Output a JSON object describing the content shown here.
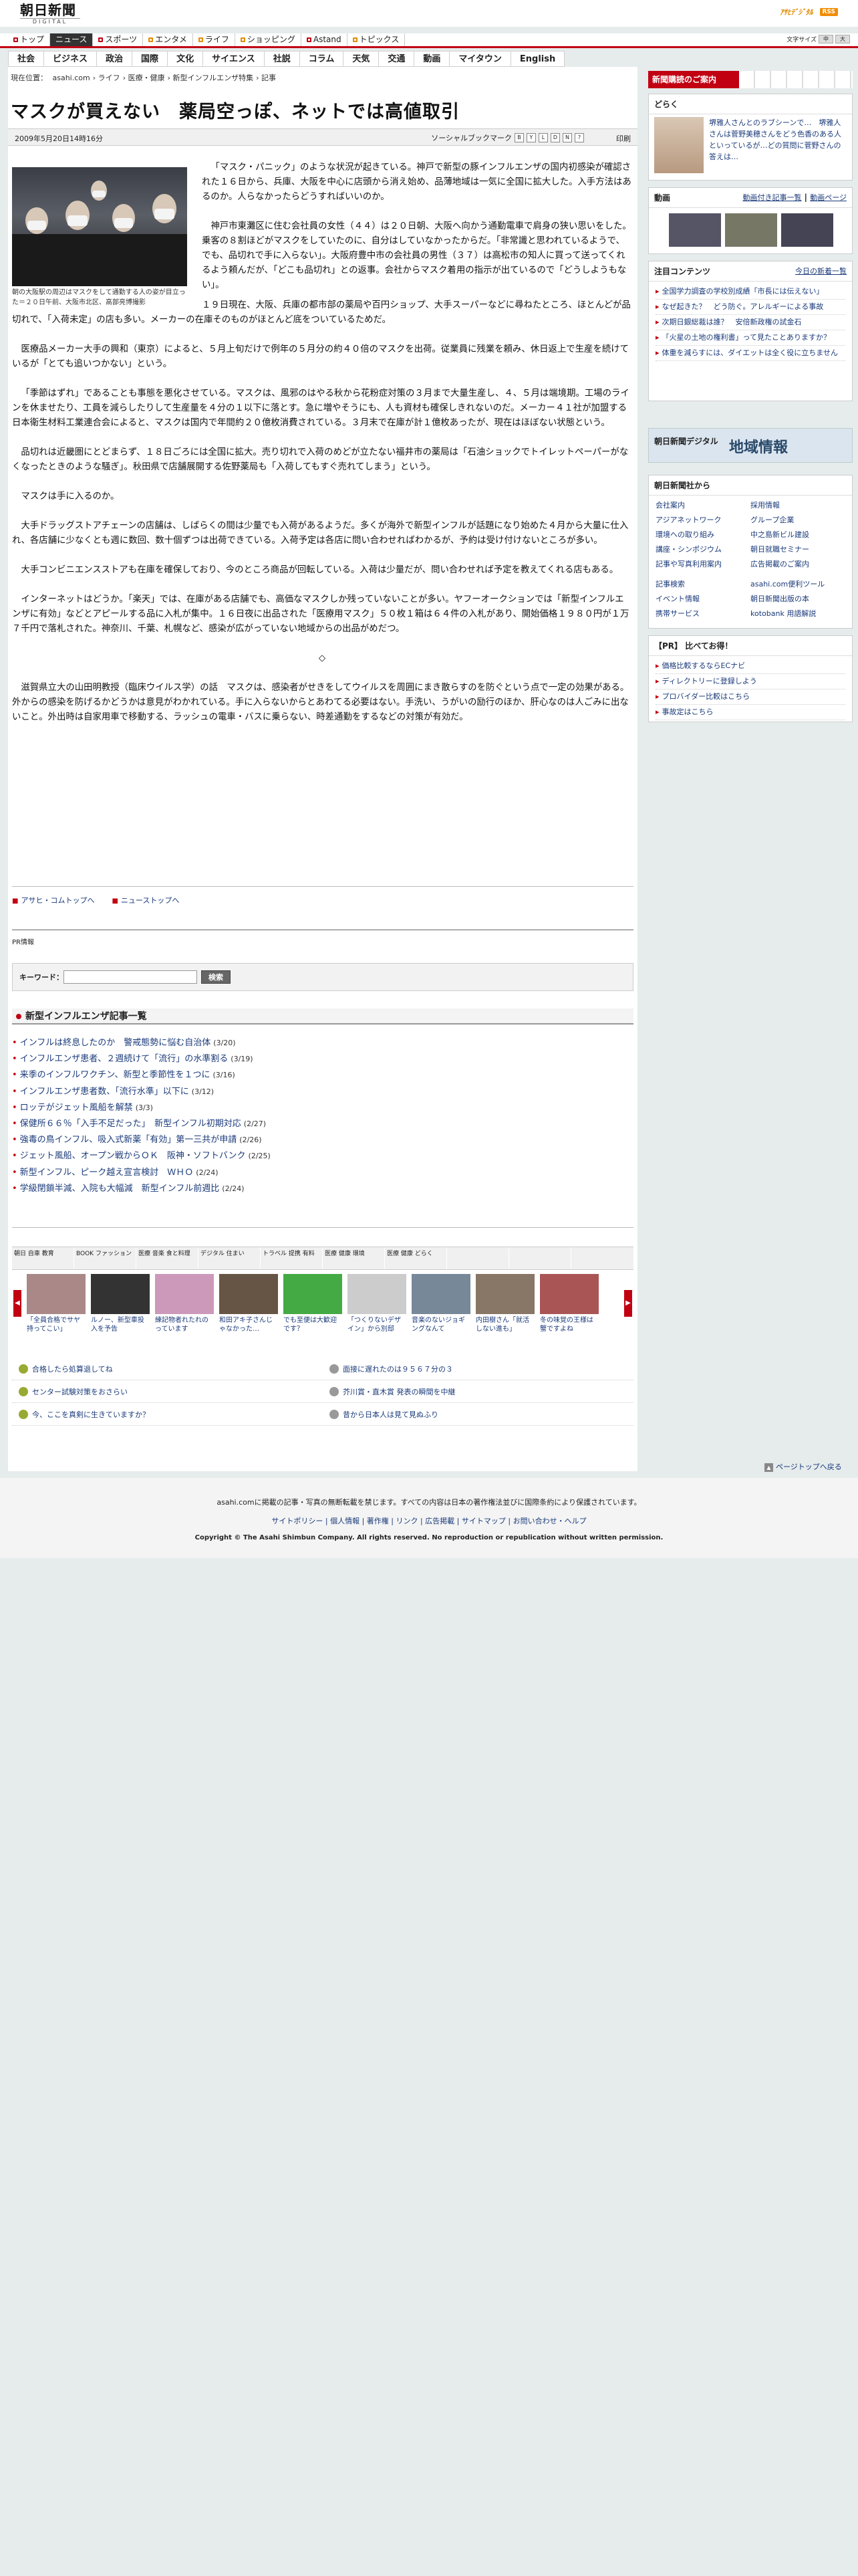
{
  "header": {
    "logo_jp": "朝日新聞",
    "logo_en": "DIGITAL",
    "pr_logo": "ｱｻﾋﾃﾞｼﾞﾀﾙ",
    "rss": "RSS",
    "text_size_label": "文字サイズ"
  },
  "global_nav": [
    "トップ",
    "ニュース",
    "スポーツ",
    "エンタメ",
    "ライフ",
    "ショッピング",
    "Astand",
    "トピックス"
  ],
  "sub_nav": [
    "社会",
    "ビジネス",
    "政治",
    "国際",
    "文化",
    "サイエンス",
    "社説",
    "コラム",
    "天気",
    "交通",
    "動画",
    "マイタウン",
    "English"
  ],
  "breadcrumb": [
    "現在位置：",
    "asahi.com",
    "ライフ",
    "医療・健康",
    "新型インフルエンザ特集",
    "記事"
  ],
  "article": {
    "title": "マスクが買えない　薬局空っぽ、ネットでは高値取引",
    "date": "2009年5月20日14時16分",
    "social_label": "ソーシャルブックマーク",
    "print_label": "印刷",
    "caption": "朝の大阪駅の周辺はマスクをして通勤する人の姿が目立った＝２０日午前、大阪市北区、高部亮博撮影",
    "paragraphs": [
      "「マスク・パニック」のような状況が起きている。神戸で新型の豚インフルエンザの国内初感染が確認された１６日から、兵庫、大阪を中心に店頭から消え始め、品薄地域は一気に全国に拡大した。入手方法はあるのか。人らなかったらどうすればいいのか。",
      "神戸市東灘区に住む会社員の女性（４４）は２０日朝、大阪へ向かう通勤電車で肩身の狭い思いをした。乗客の８割ほどがマスクをしていたのに、自分はしていなかったからだ。「非常識と思われているようで、でも、品切れで手に入らない」。大阪府豊中市の会社員の男性（３７）は高松市の知人に買って送ってくれるよう頼んだが、「どこも品切れ」との返事。会社からマスク着用の指示が出ているので「どうしようもない」。",
      "１９日現在、大阪、兵庫の都市部の薬局や百円ショップ、大手スーパーなどに尋ねたところ、ほとんどが品切れで、「入荷未定」の店も多い。メーカーの在庫そのものがほとんど底をついているためだ。",
      "医療品メーカー大手の興和（東京）によると、５月上旬だけで例年の５月分の約４０倍のマスクを出荷。従業員に残業を頼み、休日返上で生産を続けているが「とても追いつかない」という。",
      "「季節はずれ」であることも事態を悪化させている。マスクは、風邪のはやる秋から花粉症対策の３月まで大量生産し、４、５月は端境期。工場のラインを休ませたり、工員を減らしたりして生産量を４分の１以下に落とす。急に増やそうにも、人も資材も確保しきれないのだ。メーカー４１社が加盟する日本衛生材料工業連合会によると、マスクは国内で年間約２０億枚消費されている。３月末で在庫が計１億枚あったが、現在はほぼない状態という。",
      "品切れは近畿圏にとどまらず、１８日ごろには全国に拡大。売り切れで入荷のめどが立たない福井市の薬局は「石油ショックでトイレットペーパーがなくなったときのような騒ぎ」。秋田県で店舗展開する佐野薬局も「入荷してもすぐ売れてしまう」という。",
      "マスクは手に入るのか。",
      "大手ドラッグストアチェーンの店舗は、しばらくの間は少量でも入荷があるようだ。多くが海外で新型インフルが話題になり始めた４月から大量に仕入れ、各店舗に少なくとも週に数回、数十個ずつは出荷できている。入荷予定は各店に問い合わせればわかるが、予約は受け付けないところが多い。",
      "大手コンビニエンスストアも在庫を確保しており、今のところ商品が回転している。入荷は少量だが、問い合わせれば予定を教えてくれる店もある。",
      "インターネットはどうか。「楽天」では、在庫がある店舗でも、高価なマスクしか残っていないことが多い。ヤフーオークションでは「新型インフルエンザに有効」などとアピールする品に入札が集中。１６日夜に出品された「医療用マスク」５０枚１箱は６４件の入札があり、開始価格１９８０円が１万７千円で落札された。神奈川、千葉、札幌など、感染が広がっていない地域からの出品がめだつ。",
      "◇",
      "滋賀県立大の山田明教授（臨床ウイルス学）の話　マスクは、感染者がせきをしてウイルスを周囲にまき散らすのを防ぐという点で一定の効果がある。外からの感染を防げるかどうかは意見がわかれている。手に入らないからとあわてる必要はない。手洗い、うがいの励行のほか、肝心なのは人ごみに出ないこと。外出時は自家用車で移動する、ラッシュの電車・バスに乗らない、時差通勤をするなどの対策が有効だ。"
    ]
  },
  "related_links": [
    "アサヒ・コムトップへ",
    "ニューストップへ"
  ],
  "pr_info": "PR情報",
  "search": {
    "label": "キーワード：",
    "placeholder": "",
    "button": "検索"
  },
  "news_list": {
    "title": "新型インフルエンザ記事一覧",
    "items": [
      {
        "text": "インフルは終息したのか　警戒態勢に悩む自治体",
        "date": "(3/20)"
      },
      {
        "text": "インフルエンザ患者、２週続けて「流行」の水準割る",
        "date": "(3/19)"
      },
      {
        "text": "来季のインフルワクチン、新型と季節性を１つに",
        "date": "(3/16)"
      },
      {
        "text": "インフルエンザ患者数、「流行水準」以下に",
        "date": "(3/12)"
      },
      {
        "text": "ロッテがジェット風船を解禁",
        "date": "(3/3)"
      },
      {
        "text": "保健所６６％「入手不足だった」　新型インフル初期対応",
        "date": "(2/27)"
      },
      {
        "text": "強毒の鳥インフル、吸入式新薬「有効」第一三共が申請",
        "date": "(2/26)"
      },
      {
        "text": "ジェット風船、オープン戦からＯＫ　阪神・ソフトバンク",
        "date": "(2/25)"
      },
      {
        "text": "新型インフル、ピーク越え宣言検討　ＷＨＯ",
        "date": "(2/24)"
      },
      {
        "text": "学級閉鎖半減、入院も大幅減　新型インフル前週比",
        "date": "(2/24)"
      }
    ]
  },
  "carousel": {
    "categories": [
      "朝日 自車 教育",
      "BOOK ファッション",
      "医療 音楽 食と料理",
      "デジタル 住まい",
      "トラベル 提携 有料",
      "医療 健康 環境",
      "医療 健康 どらく",
      "",
      ""
    ],
    "thumbs": [
      "「全員合格でサヤ持ってこい」",
      "ルノー、新型車投入を予告",
      "練記物者れたれのっています",
      "和田アキ子さんじゃなかった…",
      "でも至便は大歓迎です？",
      "「つくりないデザイン」から別邸",
      "音楽のないジョギングなんて",
      "内田樹さん「就活しない進も」",
      "冬の味覚の王様は蟹ですよね"
    ]
  },
  "promos": [
    [
      "合格したら処算退してね",
      "面接に遅れたのは９５６７分の３"
    ],
    [
      "センター試験対策をおさらい",
      "芥川賞・直木賞 発表の瞬間を中継"
    ],
    [
      "今、ここを真剣に生きていますか？",
      "昔から日本人は見て見ぬふり"
    ]
  ],
  "page_top": "ページトップへ戻る",
  "footer": {
    "line1": "asahi.comに掲載の記事・写真の無断転載を禁じます。すべての内容は日本の著作権法並びに国際条約により保護されています。",
    "links": "サイトポリシー | 個人情報 | 著作権 | リンク | 広告掲載 | サイトマップ | お問い合わせ・ヘルプ",
    "copyright": "Copyright © The Asahi Shimbun Company. All rights reserved. No reproduction or republication without written permission."
  },
  "sidebar": {
    "banner": "新聞購読のご案内",
    "doraku": {
      "title": "どらく",
      "text": "堺雅人さんとのラブシーンで…　堺雅人さんは菅野美穂さんをどう色香のある人といっているが…どの質問に菅野さんの答えは…"
    },
    "video": {
      "title": "動画",
      "link1": "動画付き記事一覧",
      "link2": "動画ページ"
    },
    "features": {
      "title": "注目コンテンツ",
      "link": "今日の新着一覧",
      "items": [
        "全国学力調査の学校別成績「市長には伝えない」",
        "なぜ起きた？　どう防ぐ。アレルギーによる事故",
        "次期日銀総裁は誰？　安倍新政権の試金石",
        "「火星の土地の権利書」って見たことありますか？",
        "体重を減らすには、ダイエットは全く役に立ちません"
      ]
    },
    "region": {
      "t": "朝日新聞デジタル",
      "big": "地域情報"
    },
    "asahi_from": {
      "title": "朝日新聞社から",
      "items": [
        "会社案内",
        "採用情報",
        "アジアネットワーク",
        "グループ企業",
        "環境への取り組み",
        "中之島新ビル建設",
        "講座・シンポジウム",
        "朝日就職セミナー",
        "記事や写真利用案内",
        "広告掲載のご案内",
        "記事検索",
        "asahi.com便利ツール",
        "イベント情報",
        "朝日新聞出版の本",
        "携帯サービス",
        "kotobank 用語解説"
      ]
    },
    "pr": {
      "title": "【PR】 比べてお得！",
      "items": [
        "価格比較するならECナビ",
        "ディレクトリーに登録しよう",
        "プロバイダー比較はこちら",
        "事故定はこちら"
      ]
    }
  }
}
